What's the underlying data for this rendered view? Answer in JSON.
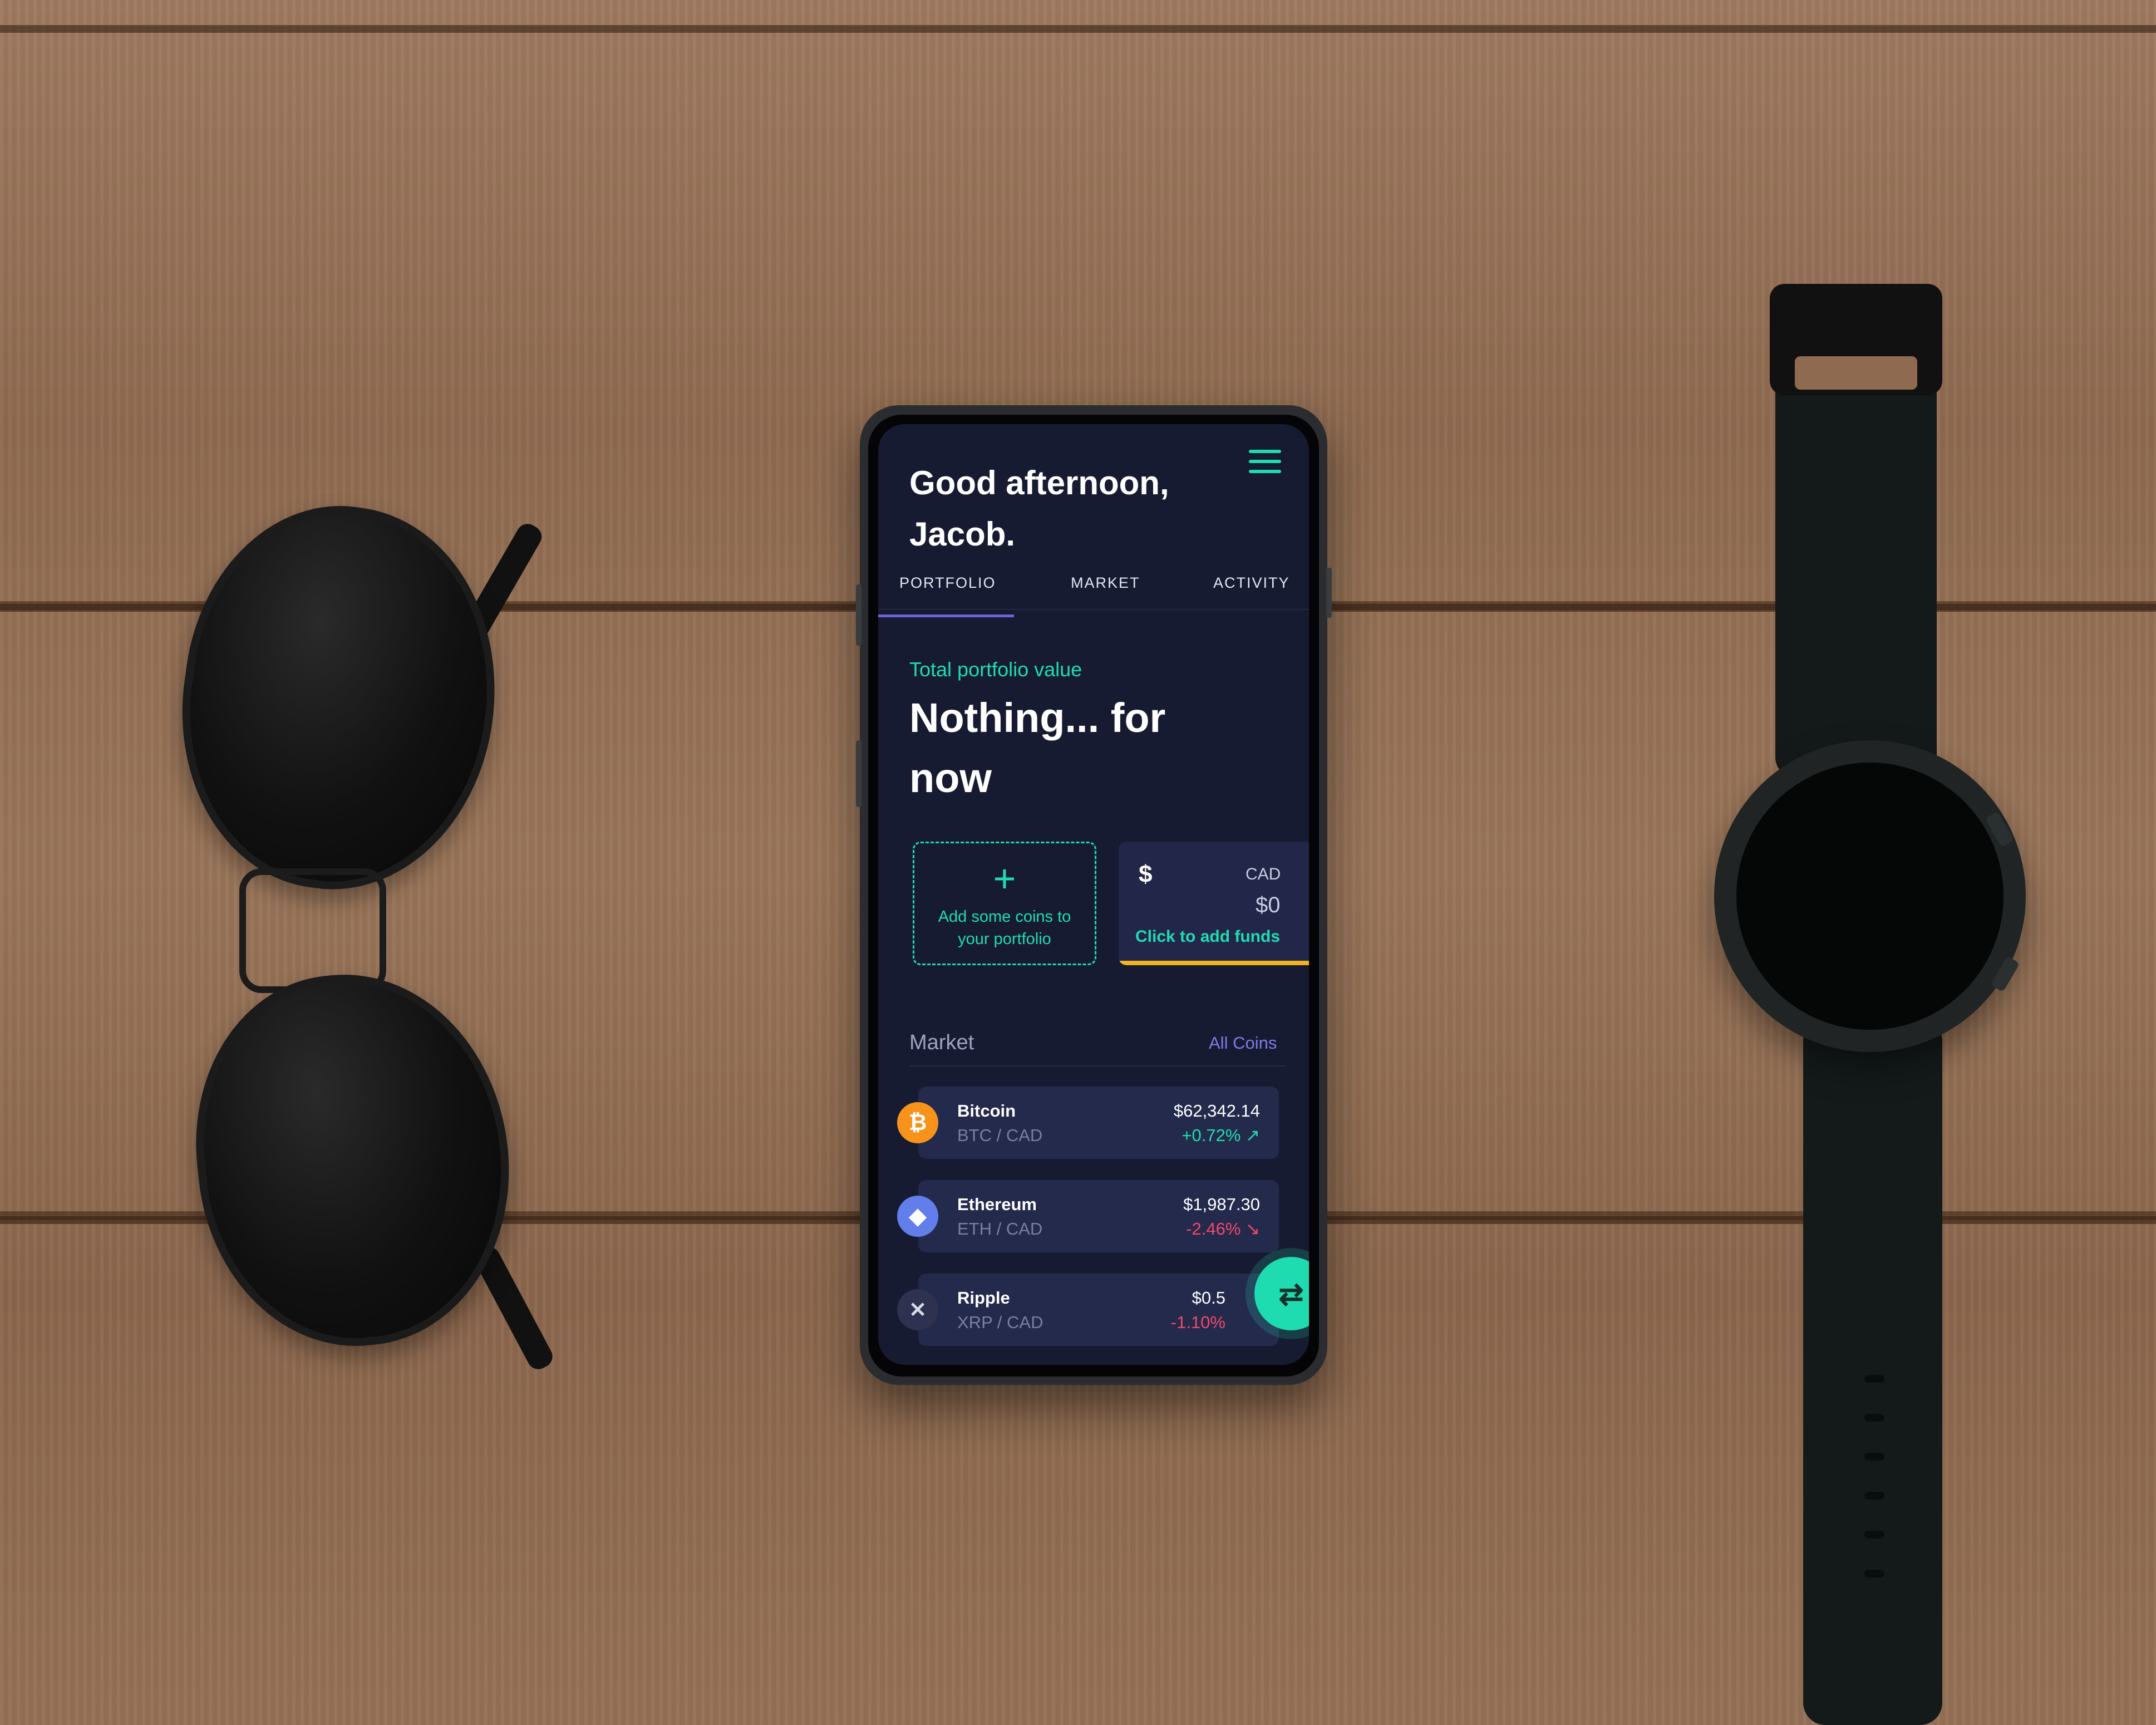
{
  "app": {
    "greeting": "Good afternoon, Jacob.",
    "tabs": [
      "PORTFOLIO",
      "MARKET",
      "ACTIVITY"
    ],
    "active_tab": "PORTFOLIO"
  },
  "portfolio": {
    "label": "Total portfolio value",
    "value": "Nothing... for now"
  },
  "add_coins_card": {
    "icon": "plus-icon",
    "text": "Add some coins to your portfolio"
  },
  "cad_card": {
    "icon": "dollar-icon",
    "currency": "CAD",
    "amount": "$0",
    "link": "Click to add funds"
  },
  "market": {
    "title": "Market",
    "all_coins_link": "All Coins",
    "coins": [
      {
        "name": "Bitcoin",
        "pair": "BTC / CAD",
        "price": "$62,342.14",
        "change": "+0.72% ↗",
        "icon": "bitcoin-icon"
      },
      {
        "name": "Ethereum",
        "pair": "ETH / CAD",
        "price": "$1,987.30",
        "change": "-2.46% ↘",
        "icon": "ethereum-icon"
      },
      {
        "name": "Ripple",
        "pair": "XRP / CAD",
        "price": "$0.5",
        "change": "-1.10%",
        "icon": "ripple-icon"
      }
    ]
  },
  "fab": {
    "icon": "swap-arrows-icon"
  },
  "colors": {
    "accent": "#1fdcb0",
    "background": "#171b31",
    "card": "#242a4c",
    "tab_indicator": "#6c63d8",
    "negative": "#f04868",
    "cad_bar": "#f4b320"
  }
}
